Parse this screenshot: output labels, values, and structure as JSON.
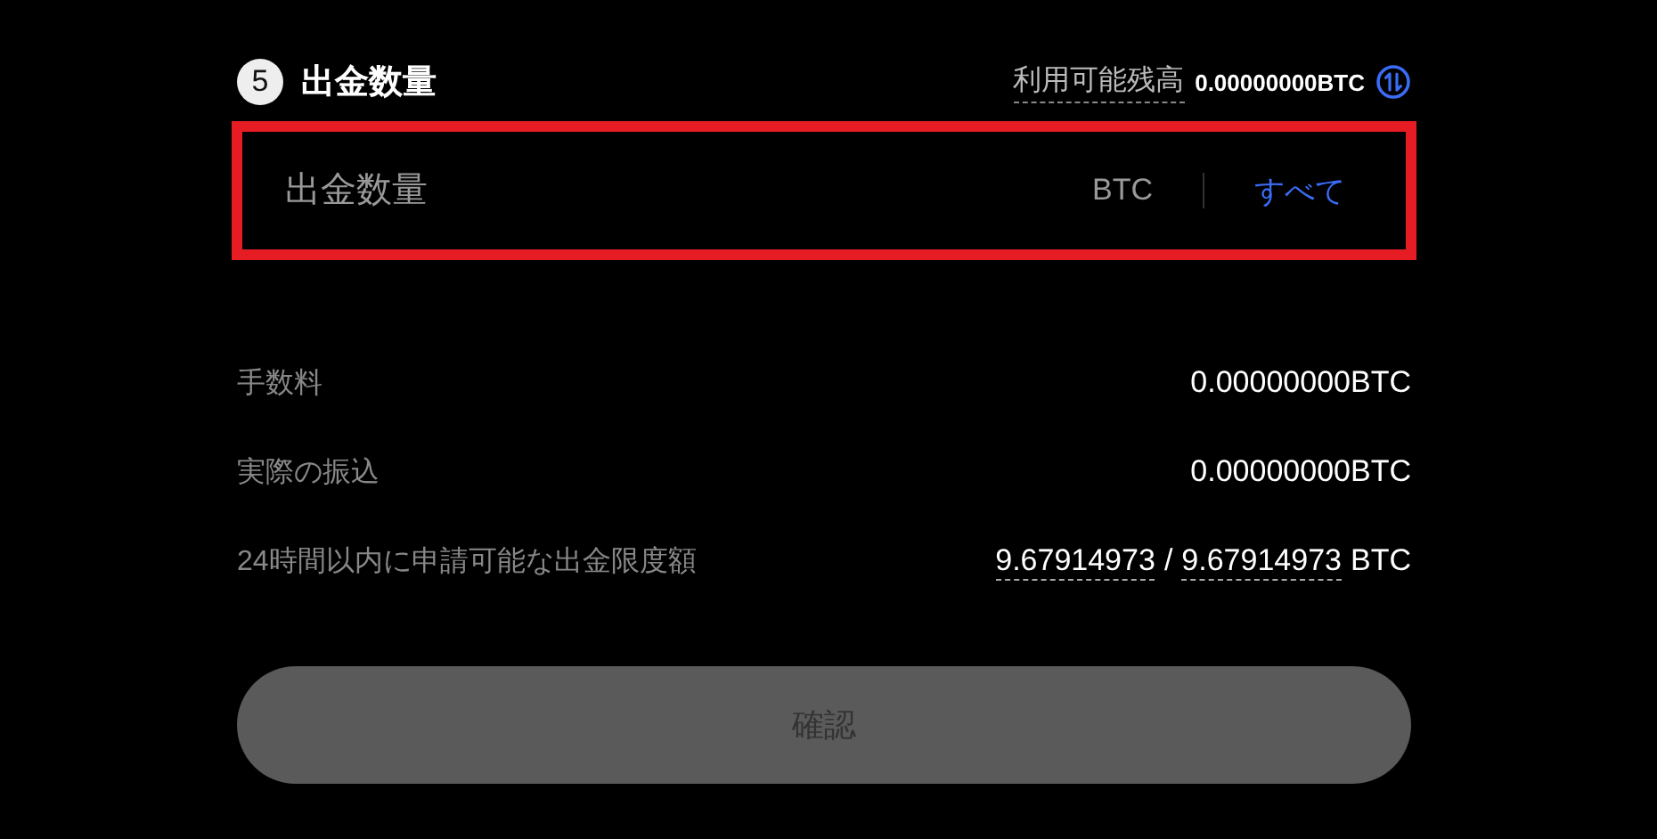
{
  "step": {
    "number": "5",
    "title": "出金数量"
  },
  "balance": {
    "label": "利用可能残高",
    "value": "0.00000000BTC"
  },
  "amount_field": {
    "placeholder": "出金数量",
    "unit": "BTC",
    "max_link": "すべて",
    "highlighted": true
  },
  "summary": [
    {
      "kind": "plain",
      "label": "手数料",
      "value": "0.00000000BTC"
    },
    {
      "kind": "plain",
      "label": "実際の振込",
      "value": "0.00000000BTC"
    },
    {
      "kind": "limit",
      "label": "24時間以内に申請可能な出金限度額",
      "used": "9.67914973",
      "separator": "/",
      "total": "9.67914973",
      "unit": "BTC"
    }
  ],
  "confirm_button": {
    "label": "確認",
    "disabled": true
  }
}
